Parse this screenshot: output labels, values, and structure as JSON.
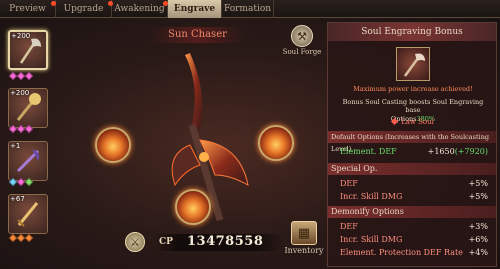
{
  "tabs": [
    {
      "label": "Preview",
      "active": false
    },
    {
      "label": "Upgrade",
      "active": false
    },
    {
      "label": "Awakening",
      "active": false
    },
    {
      "label": "Engrave Soul",
      "active": true
    },
    {
      "label": "Formation",
      "active": false
    }
  ],
  "items": [
    {
      "badge": "+200",
      "gems": [
        "#ff6ad8",
        "#ff6ad8",
        "#ff6ad8"
      ],
      "icon": "axe-icon"
    },
    {
      "badge": "+200",
      "gems": [
        "#ff6ad8",
        "#ff6ad8",
        "#ff6ad8"
      ],
      "icon": "mace-icon"
    },
    {
      "badge": "+1",
      "gems": [
        "#7ad8ff",
        "#ff6ad8",
        "#8adf6a"
      ],
      "icon": "blade-icon"
    },
    {
      "badge": "+67",
      "gems": [
        "#ff8a3a",
        "#ff8a3a",
        "#ff8a3a"
      ],
      "icon": "sword-icon"
    }
  ],
  "center": {
    "weapon_name": "Sun Chaser",
    "soul_forge_label": "Soul Forge",
    "cp_label": "CP",
    "cp_value": "13478558",
    "inventory_label": "Inventory"
  },
  "panel": {
    "title": "Soul Engraving Bonus",
    "max_message": "Maximum power increase achieved!",
    "boost_message": "Bonus Soul Casting boosts Soul Engraving base",
    "boost_options": "Options",
    "boost_percent": "380%",
    "soul_type": "Law Soul",
    "default_options_header": "Default Options (Increases with the Soulcasting Level)",
    "default_row": {
      "name": "Element. DEF",
      "value": "+1650",
      "bonus": "(+7920)"
    },
    "special_header": "Special Op.",
    "special_rows": [
      {
        "name": "DEF",
        "value": "+5%"
      },
      {
        "name": "Incr. Skill DMG",
        "value": "+5%"
      }
    ],
    "demonify_header": "Demonify Options",
    "demonify_rows": [
      {
        "name": "DEF",
        "value": "+3%"
      },
      {
        "name": "Incr. Skill DMG",
        "value": "+6%"
      },
      {
        "name": "Element. Protection DEF Rate",
        "value": "+4%"
      }
    ]
  },
  "colors": {
    "accent": "#7a3434",
    "stat_name": "#ff8f7f",
    "bonus_green": "#6adf6a"
  }
}
